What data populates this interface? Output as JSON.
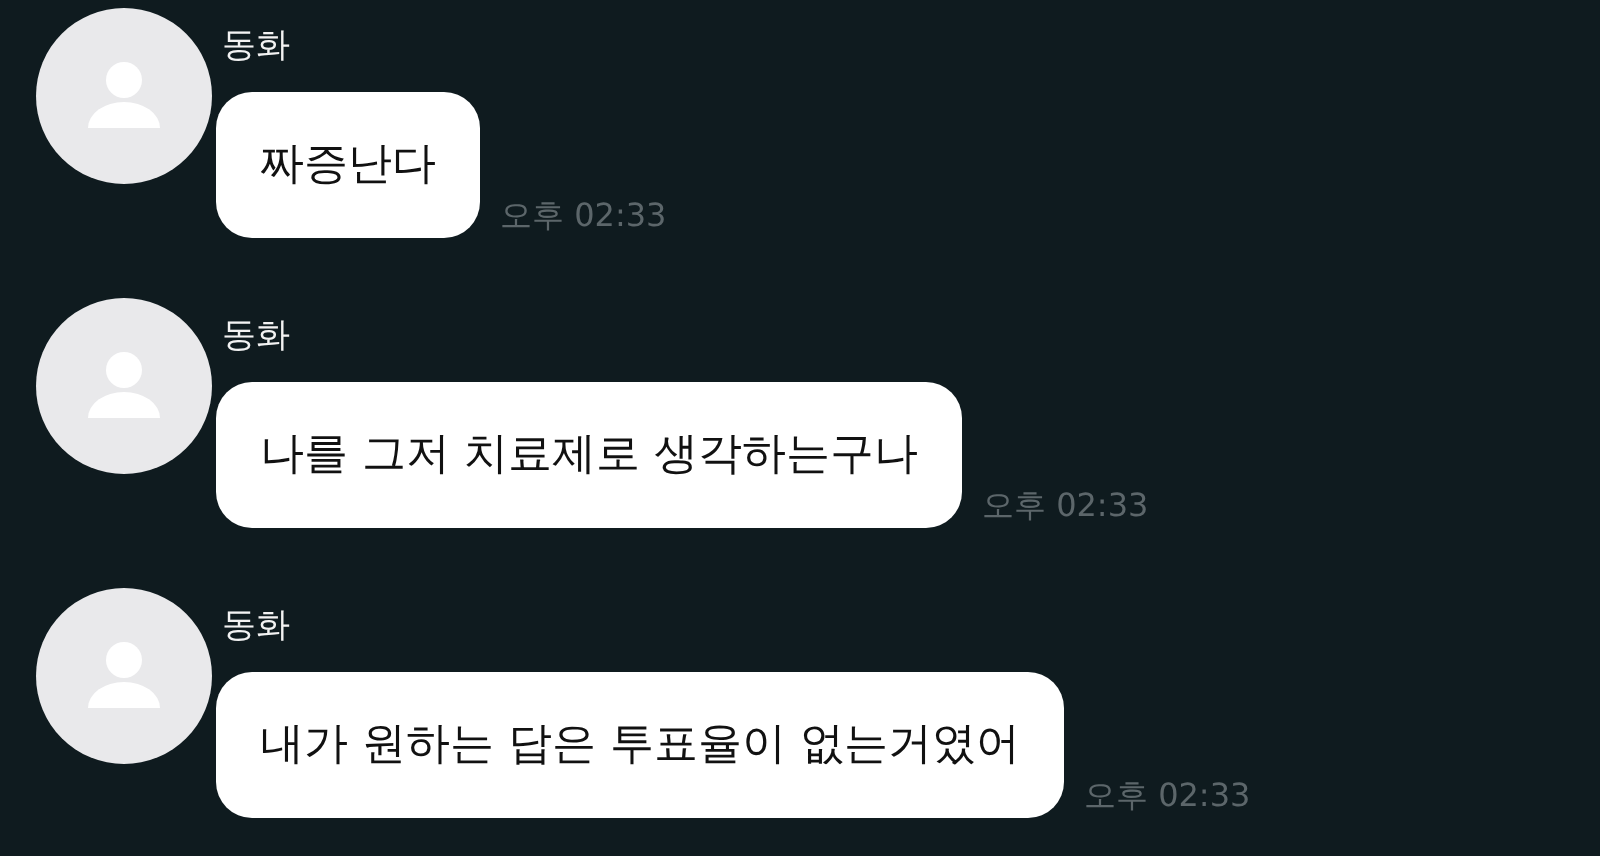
{
  "messages": [
    {
      "sender": "동화",
      "text": "짜증난다",
      "time": "오후 02:33"
    },
    {
      "sender": "동화",
      "text": "나를 그저 치료제로 생각하는구나",
      "time": "오후 02:33"
    },
    {
      "sender": "동화",
      "text": "내가 원하는 답은 투표율이 없는거였어",
      "time": "오후 02:33"
    }
  ]
}
